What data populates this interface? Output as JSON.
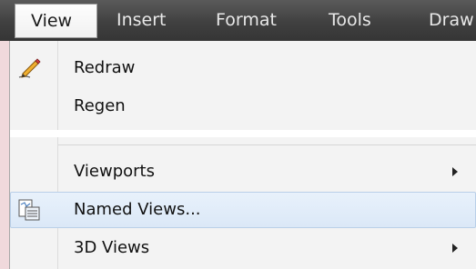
{
  "menubar": {
    "items": [
      {
        "label": "View",
        "active": true
      },
      {
        "label": "Insert",
        "active": false
      },
      {
        "label": "Format",
        "active": false
      },
      {
        "label": "Tools",
        "active": false
      },
      {
        "label": "Draw",
        "active": false
      }
    ]
  },
  "dropdown": {
    "items": [
      {
        "label": "Redraw",
        "icon": "redraw-pencil-icon",
        "submenu": false,
        "highlighted": false
      },
      {
        "label": "Regen",
        "icon": null,
        "submenu": false,
        "highlighted": false
      },
      {
        "label": "Viewports",
        "icon": null,
        "submenu": true,
        "highlighted": false
      },
      {
        "label": "Named Views...",
        "icon": "named-views-icon",
        "submenu": false,
        "highlighted": true
      },
      {
        "label": "3D Views",
        "icon": null,
        "submenu": true,
        "highlighted": false
      }
    ]
  },
  "colors": {
    "menubar_bg": "#404040",
    "menubar_text": "#e8e8e8",
    "dropdown_bg": "#f3f3f3",
    "highlight_bg": "#dbe8f7",
    "highlight_border": "#b9cfe8",
    "page_bg": "#f0d9dc"
  }
}
